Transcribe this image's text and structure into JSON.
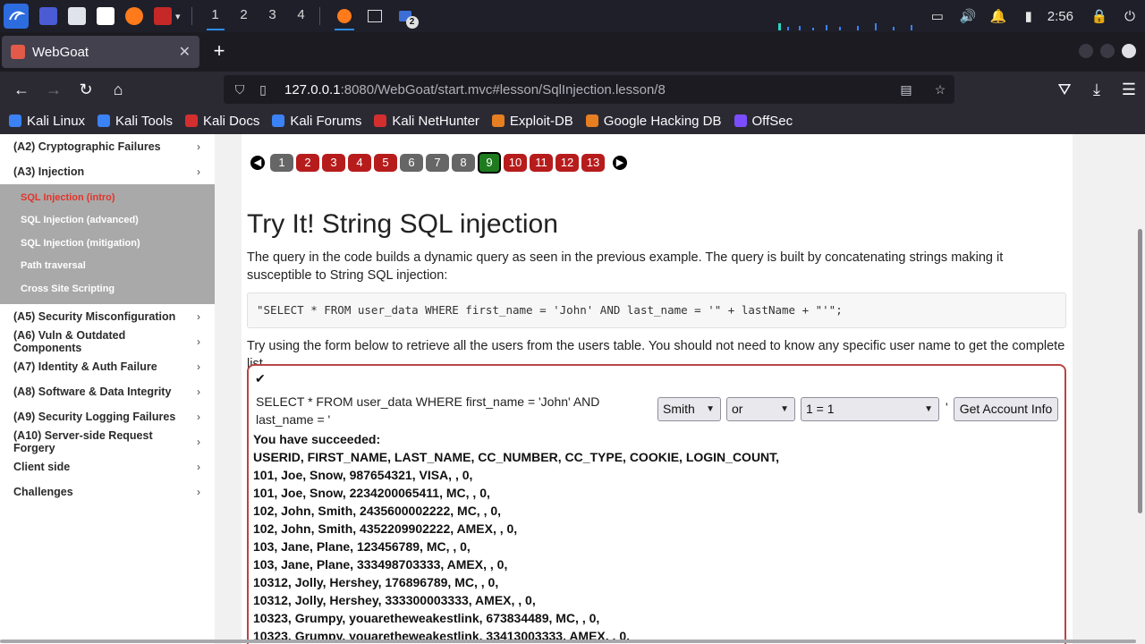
{
  "taskbar": {
    "workspaces": [
      "1",
      "2",
      "3",
      "4"
    ],
    "terminal_badge": "2",
    "clock": "2:56"
  },
  "browser": {
    "tab_title": "WebGoat",
    "url_host": "127.0.0.1",
    "url_rest": ":8080/WebGoat/start.mvc#lesson/SqlInjection.lesson/8",
    "bookmarks": [
      {
        "label": "Kali Linux",
        "color": "#3b82f6"
      },
      {
        "label": "Kali Tools",
        "color": "#3b82f6"
      },
      {
        "label": "Kali Docs",
        "color": "#d32f2f"
      },
      {
        "label": "Kali Forums",
        "color": "#3b82f6"
      },
      {
        "label": "Kali NetHunter",
        "color": "#d32f2f"
      },
      {
        "label": "Exploit-DB",
        "color": "#e67e22"
      },
      {
        "label": "Google Hacking DB",
        "color": "#e67e22"
      },
      {
        "label": "OffSec",
        "color": "#7c4dff"
      }
    ]
  },
  "sidebar": {
    "items_top": [
      {
        "label": "(A2) Cryptographic Failures"
      },
      {
        "label": "(A3) Injection"
      }
    ],
    "submenu": [
      {
        "label": "SQL Injection (intro)",
        "active": true
      },
      {
        "label": "SQL Injection (advanced)"
      },
      {
        "label": "SQL Injection (mitigation)"
      },
      {
        "label": "Path traversal"
      },
      {
        "label": "Cross Site Scripting"
      }
    ],
    "items_bottom": [
      {
        "label": "(A5) Security Misconfiguration"
      },
      {
        "label": "(A6) Vuln & Outdated Components"
      },
      {
        "label": "(A7) Identity & Auth Failure"
      },
      {
        "label": "(A8) Software & Data Integrity"
      },
      {
        "label": "(A9) Security Logging Failures"
      },
      {
        "label": "(A10) Server-side Request Forgery"
      },
      {
        "label": "Client side"
      },
      {
        "label": "Challenges"
      }
    ],
    "chevron": "›"
  },
  "lesson": {
    "pages": [
      {
        "n": "1",
        "state": "grey"
      },
      {
        "n": "2",
        "state": "red"
      },
      {
        "n": "3",
        "state": "red"
      },
      {
        "n": "4",
        "state": "red"
      },
      {
        "n": "5",
        "state": "red"
      },
      {
        "n": "6",
        "state": "grey"
      },
      {
        "n": "7",
        "state": "grey"
      },
      {
        "n": "8",
        "state": "grey"
      },
      {
        "n": "9",
        "state": "cur"
      },
      {
        "n": "10",
        "state": "red"
      },
      {
        "n": "11",
        "state": "red"
      },
      {
        "n": "12",
        "state": "red"
      },
      {
        "n": "13",
        "state": "red"
      }
    ],
    "title": "Try It! String SQL injection",
    "intro": "The query in the code builds a dynamic query as seen in the previous example. The query is built by concatenating strings making it susceptible to String SQL injection:",
    "code": "\"SELECT * FROM user_data WHERE first_name = 'John' AND last_name = '\" + lastName + \"'\";",
    "instruction": "Try using the form below to retrieve all the users from the users table. You should not need to know any specific user name to get the complete list.",
    "form": {
      "check_mark": "✔",
      "query_text": "SELECT * FROM user_data WHERE first_name = 'John' AND last_name = '",
      "select1": "Smith",
      "select2": "or",
      "select3": "1 = 1",
      "trailing_quote": "'",
      "button": "Get Account Info"
    },
    "result": {
      "status": "You have succeeded:",
      "lines": [
        "USERID, FIRST_NAME, LAST_NAME, CC_NUMBER, CC_TYPE, COOKIE, LOGIN_COUNT,",
        "101, Joe, Snow, 987654321, VISA, , 0,",
        "101, Joe, Snow, 2234200065411, MC, , 0,",
        "102, John, Smith, 2435600002222, MC, , 0,",
        "102, John, Smith, 4352209902222, AMEX, , 0,",
        "103, Jane, Plane, 123456789, MC, , 0,",
        "103, Jane, Plane, 333498703333, AMEX, , 0,",
        "10312, Jolly, Hershey, 176896789, MC, , 0,",
        "10312, Jolly, Hershey, 333300003333, AMEX, , 0,",
        "10323, Grumpy, youaretheweakestlink, 673834489, MC, , 0,",
        "10323, Grumpy, youaretheweakestlink, 33413003333, AMEX, , 0,"
      ]
    }
  }
}
